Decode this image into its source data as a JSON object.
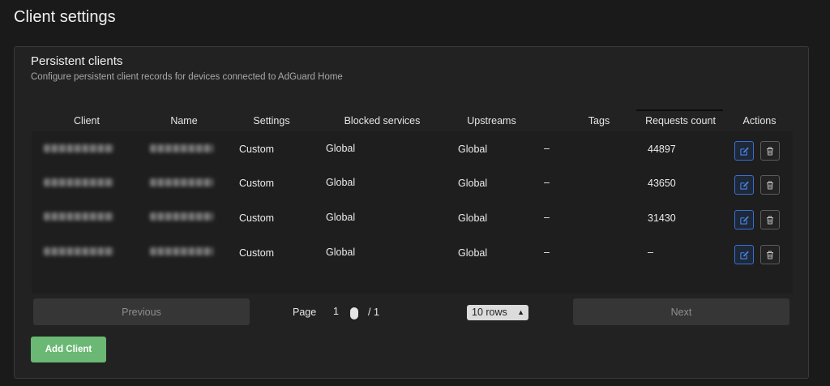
{
  "page_title": "Client settings",
  "card": {
    "title": "Persistent clients",
    "subtitle": "Configure persistent client records for devices connected to AdGuard Home"
  },
  "table": {
    "columns": [
      "Client",
      "Name",
      "Settings",
      "Blocked services",
      "Upstreams",
      "Tags",
      "Requests count",
      "Actions"
    ],
    "rows": [
      {
        "settings": "Custom",
        "blocked_services": "Global",
        "upstreams": "Global",
        "tags": "–",
        "requests": "44897"
      },
      {
        "settings": "Custom",
        "blocked_services": "Global",
        "upstreams": "Global",
        "tags": "–",
        "requests": "43650"
      },
      {
        "settings": "Custom",
        "blocked_services": "Global",
        "upstreams": "Global",
        "tags": "–",
        "requests": "31430"
      },
      {
        "settings": "Custom",
        "blocked_services": "Global",
        "upstreams": "Global",
        "tags": "–",
        "requests": "–"
      }
    ]
  },
  "pagination": {
    "previous_label": "Previous",
    "next_label": "Next",
    "page_label": "Page",
    "current_page": "1",
    "total_pages": "/ 1",
    "rows_option": "10 rows"
  },
  "add_client_label": "Add Client",
  "icons": {
    "edit": "edit-icon",
    "delete": "trash-icon"
  },
  "colors": {
    "accent_blue": "#3c6fd0",
    "add_button": "#6ab873"
  }
}
